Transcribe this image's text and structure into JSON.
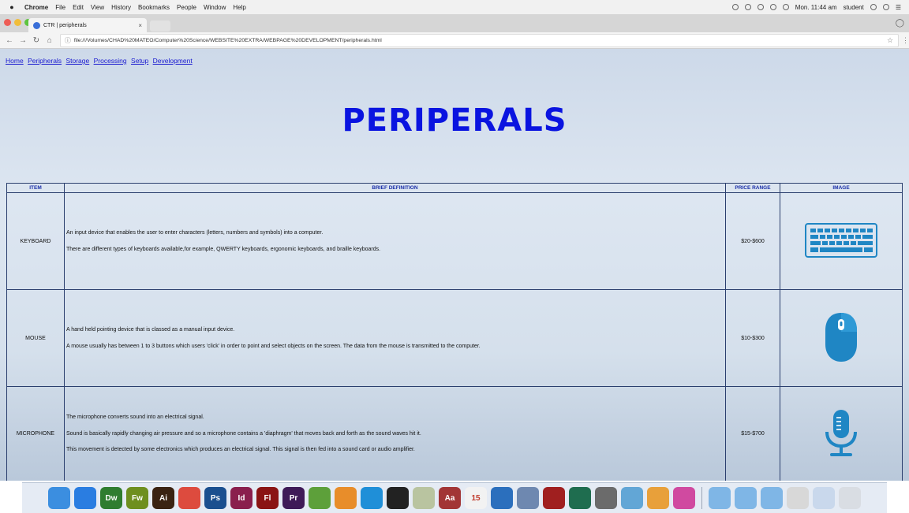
{
  "menubar": {
    "app": "Chrome",
    "items": [
      "File",
      "Edit",
      "View",
      "History",
      "Bookmarks",
      "People",
      "Window",
      "Help"
    ],
    "clock": "Mon. 11:44 am",
    "user": "student"
  },
  "tab": {
    "title": "CTR | peripherals",
    "close": "×"
  },
  "address_bar": {
    "url": "file:///Volumes/CHAD%20MATEO/Computer%20Science/WEBSITE%20EXTRA/WEBPAGE%20DEVELOPMENT/peripherals.html"
  },
  "nav_links": [
    "Home",
    "Peripherals",
    "Storage",
    "Processing",
    "Setup",
    "Development"
  ],
  "page_title": "PERIPERALS",
  "table": {
    "headers": [
      "ITEM",
      "BRIEF DEFINITION",
      "PRICE RANGE",
      "IMAGE"
    ],
    "rows": [
      {
        "item": "KEYBOARD",
        "definition": [
          "An input device that enables the user to enter characters (letters, numbers and symbols) into a computer.",
          "There are different types of keyboards available,for example, QWERTY keyboards, ergonomic keyboards, and braille keyboards."
        ],
        "price": "$20-$600",
        "icon": "keyboard-icon"
      },
      {
        "item": "MOUSE",
        "definition": [
          "A hand held pointing device that is classed as a manual input device.",
          "A mouse usually has between 1 to 3 buttons which users 'click' in order to point and select objects on the screen. The data from the mouse is transmitted to the computer."
        ],
        "price": "$10-$300",
        "icon": "mouse-icon"
      },
      {
        "item": "MICROPHONE",
        "definition": [
          "The microphone converts sound into an electrical signal.",
          "Sound is basically rapidly changing air pressure and so a microphone contains a 'diaphragm' that moves back and forth as the sound waves hit it.",
          "This movement is detected by some electronics which produces an electrical signal. This signal is then fed into a sound card or audio amplifier."
        ],
        "price": "$15-$700",
        "icon": "microphone-icon"
      }
    ]
  },
  "dock": {
    "apps": [
      {
        "name": "finder",
        "label": "",
        "color": "#3b8ee0"
      },
      {
        "name": "safari",
        "label": "",
        "color": "#2a7de1"
      },
      {
        "name": "dreamweaver",
        "label": "Dw",
        "color": "#2f7d2f"
      },
      {
        "name": "fireworks",
        "label": "Fw",
        "color": "#6e8f1f"
      },
      {
        "name": "illustrator",
        "label": "Ai",
        "color": "#3a2312"
      },
      {
        "name": "chrome",
        "label": "",
        "color": "#dd4b3e"
      },
      {
        "name": "photoshop",
        "label": "Ps",
        "color": "#1a4f8f"
      },
      {
        "name": "indesign",
        "label": "Id",
        "color": "#8a1f4d"
      },
      {
        "name": "flash",
        "label": "Fl",
        "color": "#8a1414"
      },
      {
        "name": "premiere",
        "label": "Pr",
        "color": "#3e1a57"
      },
      {
        "name": "app-green",
        "label": "",
        "color": "#5da03a"
      },
      {
        "name": "app-orange",
        "label": "",
        "color": "#e88d2a"
      },
      {
        "name": "app-blue",
        "label": "",
        "color": "#1f8fd8"
      },
      {
        "name": "app-dark",
        "label": "",
        "color": "#222222"
      },
      {
        "name": "app-feather",
        "label": "",
        "color": "#b9c4a0"
      },
      {
        "name": "dictionary",
        "label": "Aa",
        "color": "#a23535"
      },
      {
        "name": "calendar",
        "label": "15",
        "color": "#f2f2f2"
      },
      {
        "name": "app-globe",
        "label": "",
        "color": "#2b6fbd"
      },
      {
        "name": "app-preview",
        "label": "",
        "color": "#6e88b0"
      },
      {
        "name": "photo-booth",
        "label": "",
        "color": "#a01f1f"
      },
      {
        "name": "time-machine",
        "label": "",
        "color": "#1f6d4f"
      },
      {
        "name": "system-prefs",
        "label": "",
        "color": "#6b6b6b"
      },
      {
        "name": "app-map",
        "label": "",
        "color": "#62a6d6"
      },
      {
        "name": "photos",
        "label": "",
        "color": "#e8a03a"
      },
      {
        "name": "itunes",
        "label": "",
        "color": "#d04aa0"
      },
      {
        "name": "folder-apps",
        "label": "",
        "color": "#7fb6e6"
      },
      {
        "name": "folder-docs",
        "label": "",
        "color": "#7fb6e6"
      },
      {
        "name": "folder-downloads",
        "label": "",
        "color": "#7fb6e6"
      },
      {
        "name": "folder-other",
        "label": "",
        "color": "#d8d8d8"
      },
      {
        "name": "stack",
        "label": "",
        "color": "#c9d8ec"
      },
      {
        "name": "trash",
        "label": "",
        "color": "#d9dde3"
      }
    ]
  },
  "colors": {
    "title": "#0a14e0",
    "link": "#1a1ad0",
    "header_text": "#1b2fa8",
    "icon_blue": "#1f86c4"
  }
}
